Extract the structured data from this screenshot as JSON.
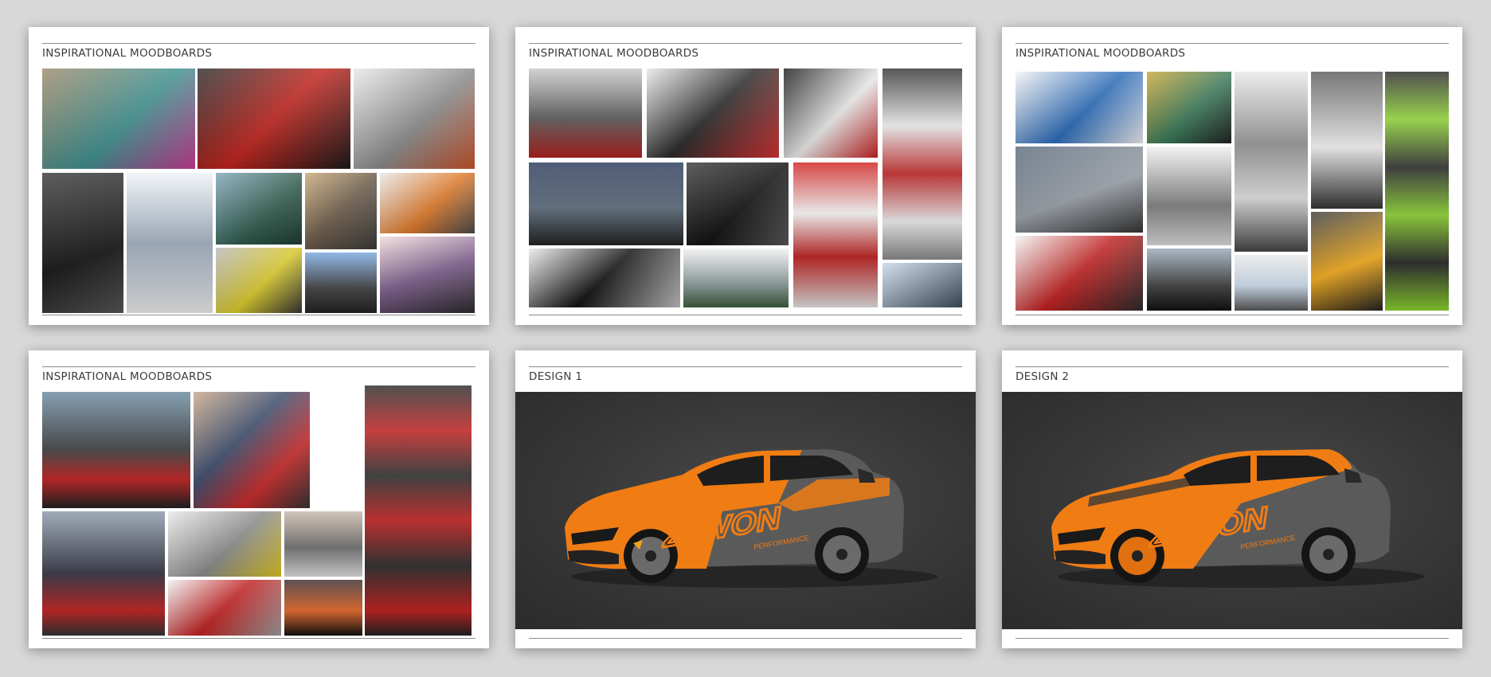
{
  "slides": [
    {
      "title": "INSPIRATIONAL MOODBOARDS"
    },
    {
      "title": "INSPIRATIONAL MOODBOARDS"
    },
    {
      "title": "INSPIRATIONAL MOODBOARDS"
    },
    {
      "title": "INSPIRATIONAL MOODBOARDS"
    },
    {
      "title": "DESIGN 1",
      "livery_text": "27WON",
      "livery_sub": "PERFORMANCE"
    },
    {
      "title": "DESIGN 2",
      "livery_text": "27WON",
      "livery_sub": "PERFORMANCE"
    }
  ],
  "colors": {
    "page_bg": "#d8d8d8",
    "card_bg": "#ffffff",
    "rule": "#8c8c8c",
    "title_text": "#3c3c3c",
    "livery_orange": "#f07c14",
    "livery_grey": "#5a5a5a",
    "design_bg": "#373737"
  }
}
